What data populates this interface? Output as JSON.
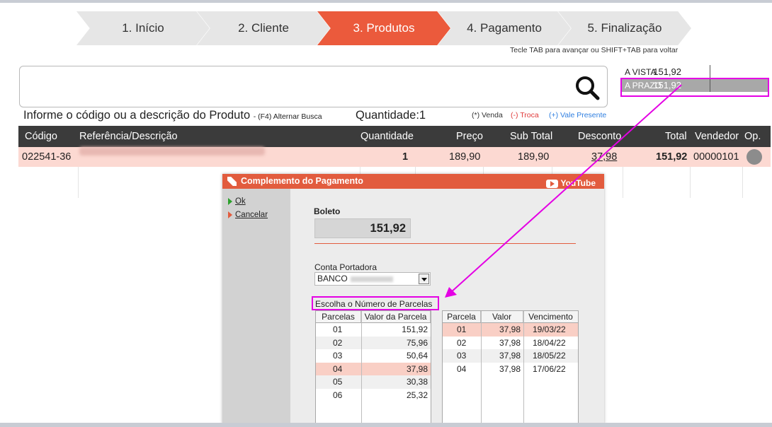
{
  "wizard": {
    "steps": [
      "1. Início",
      "2. Cliente",
      "3. Produtos",
      "4. Pagamento",
      "5. Finalização"
    ],
    "active_index": 2,
    "hint": "Tecle TAB para avançar ou SHIFT+TAB para voltar"
  },
  "search": {
    "value": "",
    "icon": "search-icon"
  },
  "prices": {
    "rows": [
      {
        "label": "A VISTA",
        "value": "151,92"
      },
      {
        "label": "A PRAZO",
        "value": "151,92"
      }
    ],
    "selected_index": 1
  },
  "product_hint": {
    "text": "Informe o código ou a descrição do Produto",
    "alt_search": "- (F4) Alternar Busca",
    "quantity_label": "Quantidade:",
    "quantity_value": "1"
  },
  "legend": {
    "venda": "(*) Venda",
    "troca": "(-) Troca",
    "vale": "(+) Vale Presente"
  },
  "colors": {
    "accent": "#eb5a3c",
    "venda": "#333333",
    "troca": "#e03a3a",
    "vale": "#2f7fe0",
    "highlight": "#e400e4"
  },
  "grid": {
    "columns": [
      "Código",
      "Referência/Descrição",
      "Quantidade",
      "Preço",
      "Sub Total",
      "Desconto",
      "Total",
      "Vendedor",
      "Op."
    ],
    "row": {
      "codigo": "022541-36",
      "descricao": "",
      "quantidade": "1",
      "preco": "189,90",
      "subtotal": "189,90",
      "desconto": "37,98",
      "total": "151,92",
      "vendedor": "00000101"
    }
  },
  "dialog": {
    "title": "Complemento do Pagamento",
    "youtube": "YouTube",
    "actions": [
      "Ok",
      "Cancelar"
    ],
    "method_label": "Boleto",
    "amount": "151,92",
    "account_label": "Conta Portadora",
    "account_value": "BANCO",
    "installments_label": "Escolha o Número de Parcelas",
    "left_table": {
      "headers": [
        "Parcelas",
        "Valor da Parcela"
      ],
      "rows": [
        [
          "01",
          "151,92"
        ],
        [
          "02",
          "75,96"
        ],
        [
          "03",
          "50,64"
        ],
        [
          "04",
          "37,98"
        ],
        [
          "05",
          "30,38"
        ],
        [
          "06",
          "25,32"
        ]
      ],
      "selected_index": 3
    },
    "right_table": {
      "headers": [
        "Parcela",
        "Valor",
        "Vencimento"
      ],
      "rows": [
        [
          "01",
          "37,98",
          "19/03/22"
        ],
        [
          "02",
          "37,98",
          "18/04/22"
        ],
        [
          "03",
          "37,98",
          "18/05/22"
        ],
        [
          "04",
          "37,98",
          "17/06/22"
        ]
      ],
      "selected_index": 0
    }
  }
}
